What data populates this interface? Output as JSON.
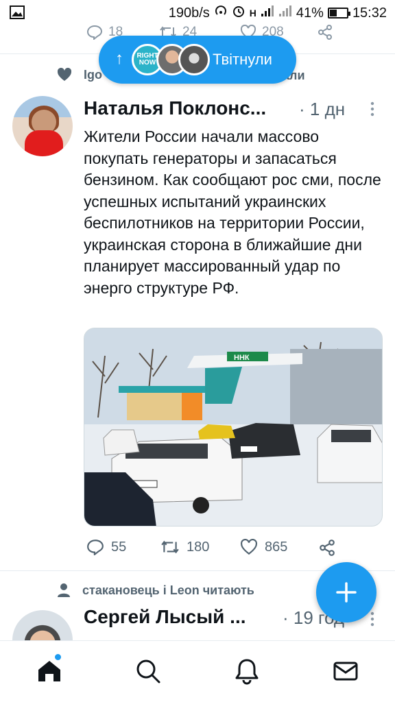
{
  "status_bar": {
    "speed": "190b/s",
    "battery_percent": "41%",
    "battery_level": 0.41,
    "time": "15:32",
    "network": "H"
  },
  "prev_tweet_actions": {
    "replies": "18",
    "retweets": "24",
    "likes": "208"
  },
  "new_tweets_pill": {
    "label": "Твітнули",
    "avatar1_text": "RIGHT NOW"
  },
  "tweet": {
    "context_visible": "Igo",
    "context_hidden_tail": "али",
    "author_name": "Наталья Поклонс...",
    "time": "· 1 дн",
    "text": "Жители России начали массово покупать генераторы и запасаться бензином. Как сообщают рос сми, после успешных испытаний украинских беспилотников на территории России, украинская сторона в ближайшие дни планирует массированный удар по энерго структуре РФ.",
    "media_sign": "ННК",
    "actions": {
      "replies": "55",
      "retweets": "180",
      "likes": "865"
    }
  },
  "tweet2": {
    "context": "стакановець і Leon читають",
    "author_name": "Сергей Лысый ...",
    "time": "· 19 год"
  },
  "colors": {
    "accent": "#1d9bf0",
    "text": "#0f1419",
    "secondary": "#536471"
  },
  "icons": {
    "fab": "compose-icon",
    "nav": [
      "home-icon",
      "search-icon",
      "bell-icon",
      "mail-icon"
    ]
  }
}
